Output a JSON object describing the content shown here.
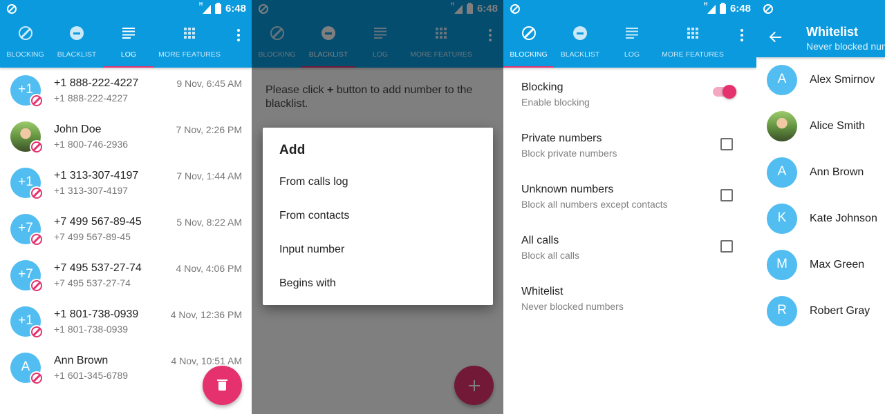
{
  "status_bar": {
    "time": "6:48",
    "network": "H"
  },
  "tabs": [
    {
      "label": "BLOCKING",
      "icon": "block-icon"
    },
    {
      "label": "BLACKLIST",
      "icon": "minus-circle-icon"
    },
    {
      "label": "LOG",
      "icon": "log-list-icon"
    },
    {
      "label": "MORE FEATURES",
      "icon": "apps-grid-icon"
    }
  ],
  "menu_icon": "more-vert-icon",
  "colors": {
    "primary": "#0b9ade",
    "accent": "#e5326e",
    "avatar": "#52bdf1"
  },
  "log": {
    "active_tab": "LOG",
    "items": [
      {
        "avatar": "+1",
        "title": "+1 888-222-4227",
        "number": "+1 888-222-4227",
        "time": "9 Nov, 6:45 AM",
        "blocked": true
      },
      {
        "avatar": "photo",
        "title": "John Doe",
        "number": "+1 800-746-2936",
        "time": "7 Nov, 2:26 PM",
        "blocked": true
      },
      {
        "avatar": "+1",
        "title": "+1 313-307-4197",
        "number": "+1 313-307-4197",
        "time": "7 Nov, 1:44 AM",
        "blocked": true
      },
      {
        "avatar": "+7",
        "title": "+7 499 567-89-45",
        "number": "+7 499 567-89-45",
        "time": "5 Nov, 8:22 AM",
        "blocked": true
      },
      {
        "avatar": "+7",
        "title": "+7 495 537-27-74",
        "number": "+7 495 537-27-74",
        "time": "4 Nov, 4:06 PM",
        "blocked": true
      },
      {
        "avatar": "+1",
        "title": "+1 801-738-0939",
        "number": "+1 801-738-0939",
        "time": "4 Nov, 12:36 PM",
        "blocked": true
      },
      {
        "avatar": "A",
        "title": "Ann Brown",
        "number": "+1 601-345-6789",
        "time": "4 Nov, 10:51 AM",
        "blocked": true
      }
    ],
    "fab_icon": "trash-icon"
  },
  "blacklist": {
    "active_tab": "BLACKLIST",
    "message_pre": "Please click ",
    "message_plus": "+",
    "message_post": " button to add number to the blacklist.",
    "dialog": {
      "title": "Add",
      "items": [
        "From calls log",
        "From contacts",
        "Input number",
        "Begins with"
      ]
    },
    "fab_icon": "plus-icon"
  },
  "blocking": {
    "active_tab": "BLOCKING",
    "settings": [
      {
        "title": "Blocking",
        "subtitle": "Enable blocking",
        "control": "switch",
        "checked": true
      },
      {
        "title": "Private numbers",
        "subtitle": "Block private numbers",
        "control": "checkbox",
        "checked": false
      },
      {
        "title": "Unknown numbers",
        "subtitle": "Block all numbers except contacts",
        "control": "checkbox",
        "checked": false
      },
      {
        "title": "All calls",
        "subtitle": "Block all calls",
        "control": "checkbox",
        "checked": false
      },
      {
        "title": "Whitelist",
        "subtitle": "Never blocked numbers",
        "control": "none"
      }
    ]
  },
  "whitelist": {
    "title": "Whitelist",
    "subtitle": "Never blocked numbers",
    "contacts": [
      {
        "avatar": "A",
        "name": "Alex Smirnov"
      },
      {
        "avatar": "photo",
        "name": "Alice Smith"
      },
      {
        "avatar": "A",
        "name": "Ann Brown"
      },
      {
        "avatar": "K",
        "name": "Kate Johnson"
      },
      {
        "avatar": "M",
        "name": "Max Green"
      },
      {
        "avatar": "R",
        "name": "Robert Gray"
      }
    ]
  }
}
